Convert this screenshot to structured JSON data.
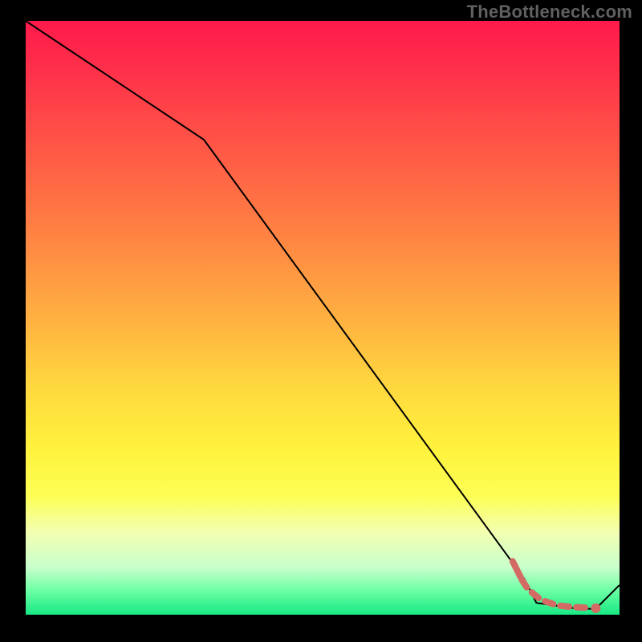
{
  "watermark": "TheBottleneck.com",
  "colors": {
    "accent_salmon": "#d36a63",
    "curve": "#000000"
  },
  "chart_data": {
    "type": "line",
    "title": "",
    "xlabel": "",
    "ylabel": "",
    "xlim": [
      0,
      100
    ],
    "ylim": [
      0,
      100
    ],
    "grid": false,
    "legend": null,
    "series": [
      {
        "name": "primary-curve",
        "style": "solid",
        "color": "#000000",
        "x": [
          0,
          30,
          84,
          86,
          93,
          96,
          100
        ],
        "values": [
          100,
          80,
          6,
          2,
          1,
          1,
          5
        ]
      },
      {
        "name": "highlight-segment",
        "style": "dashed-thick",
        "color": "#d36a63",
        "x": [
          82,
          84,
          86,
          88,
          90,
          92,
          94,
          96
        ],
        "values": [
          9,
          5,
          3,
          2,
          1.5,
          1.3,
          1.2,
          1.1
        ]
      }
    ],
    "points": [
      {
        "name": "highlight-dot",
        "x": 96,
        "y": 1.1,
        "color": "#d36a63"
      }
    ]
  }
}
